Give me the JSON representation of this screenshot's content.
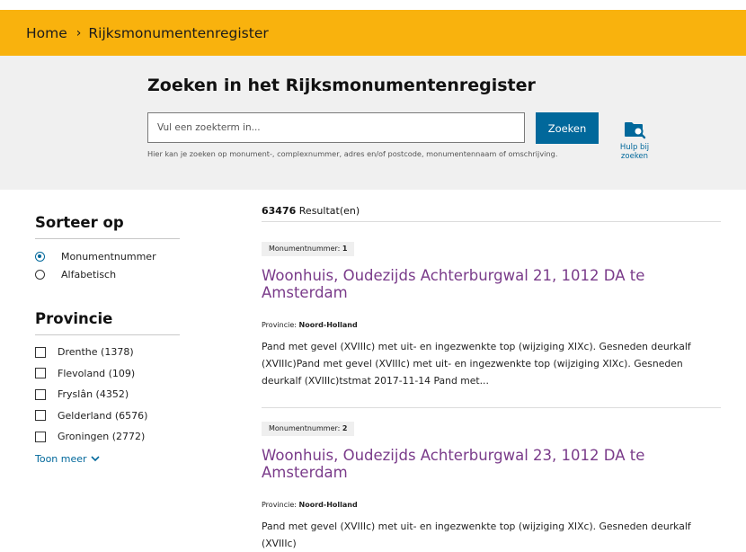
{
  "breadcrumb": {
    "home": "Home",
    "separator": "›",
    "current": "Rijksmonumentenregister"
  },
  "search": {
    "title": "Zoeken in het Rijksmonumentenregister",
    "placeholder": "Vul een zoekterm in...",
    "button": "Zoeken",
    "hint": "Hier kan je zoeken op monument-, complexnummer, adres en/of postcode, monumentennaam of omschrijving.",
    "help_label": "Hulp bij zoeken"
  },
  "sort": {
    "title": "Sorteer op",
    "options": [
      {
        "label": "Monumentnummer",
        "selected": true
      },
      {
        "label": "Alfabetisch",
        "selected": false
      }
    ]
  },
  "provinces": {
    "title": "Provincie",
    "items": [
      {
        "label": "Drenthe (1378)"
      },
      {
        "label": "Flevoland (109)"
      },
      {
        "label": "Fryslân (4352)"
      },
      {
        "label": "Gelderland (6576)"
      },
      {
        "label": "Groningen (2772)"
      }
    ],
    "more": "Toon meer"
  },
  "results": {
    "count": "63476",
    "count_suffix": " Resultat(en)",
    "items": [
      {
        "number_label": "Monumentnummer:",
        "number": "1",
        "title": "Woonhuis, Oudezijds Achterburgwal 21, 1012 DA te Amsterdam",
        "province_label": "Provincie:",
        "province": "Noord-Holland",
        "description": "Pand met gevel (XVIIIc) met uit- en ingezwenkte top (wijziging XIXc). Gesneden deurkalf (XVIIIc)Pand met gevel (XVIIIc) met uit- en ingezwenkte top (wijziging XIXc). Gesneden deurkalf (XVIIIc)tstmat 2017-11-14 Pand met..."
      },
      {
        "number_label": "Monumentnummer:",
        "number": "2",
        "title": "Woonhuis, Oudezijds Achterburgwal 23, 1012 DA te Amsterdam",
        "province_label": "Provincie:",
        "province": "Noord-Holland",
        "description": "Pand met gevel (XVIIIc) met uit- en ingezwenkte top (wijziging XIXc). Gesneden deurkalf (XVIIIc)"
      }
    ]
  },
  "colors": {
    "accent_bar": "#f9b20d",
    "primary_blue": "#01689b",
    "link_purple": "#7a3b8a"
  }
}
